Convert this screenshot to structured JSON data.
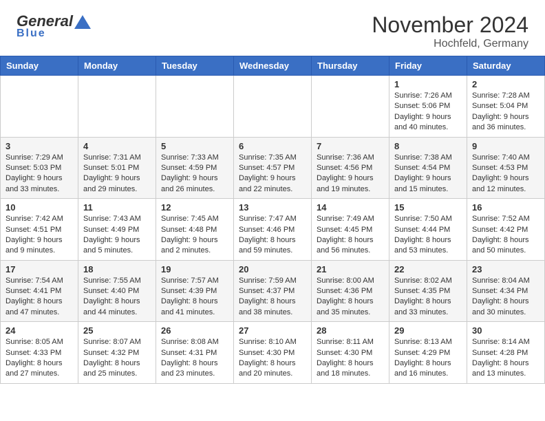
{
  "header": {
    "logo_general": "General",
    "logo_blue": "Blue",
    "month_title": "November 2024",
    "location": "Hochfeld, Germany"
  },
  "days_of_week": [
    "Sunday",
    "Monday",
    "Tuesday",
    "Wednesday",
    "Thursday",
    "Friday",
    "Saturday"
  ],
  "weeks": [
    {
      "days": [
        {
          "num": "",
          "detail": ""
        },
        {
          "num": "",
          "detail": ""
        },
        {
          "num": "",
          "detail": ""
        },
        {
          "num": "",
          "detail": ""
        },
        {
          "num": "",
          "detail": ""
        },
        {
          "num": "1",
          "detail": "Sunrise: 7:26 AM\nSunset: 5:06 PM\nDaylight: 9 hours and 40 minutes."
        },
        {
          "num": "2",
          "detail": "Sunrise: 7:28 AM\nSunset: 5:04 PM\nDaylight: 9 hours and 36 minutes."
        }
      ]
    },
    {
      "days": [
        {
          "num": "3",
          "detail": "Sunrise: 7:29 AM\nSunset: 5:03 PM\nDaylight: 9 hours and 33 minutes."
        },
        {
          "num": "4",
          "detail": "Sunrise: 7:31 AM\nSunset: 5:01 PM\nDaylight: 9 hours and 29 minutes."
        },
        {
          "num": "5",
          "detail": "Sunrise: 7:33 AM\nSunset: 4:59 PM\nDaylight: 9 hours and 26 minutes."
        },
        {
          "num": "6",
          "detail": "Sunrise: 7:35 AM\nSunset: 4:57 PM\nDaylight: 9 hours and 22 minutes."
        },
        {
          "num": "7",
          "detail": "Sunrise: 7:36 AM\nSunset: 4:56 PM\nDaylight: 9 hours and 19 minutes."
        },
        {
          "num": "8",
          "detail": "Sunrise: 7:38 AM\nSunset: 4:54 PM\nDaylight: 9 hours and 15 minutes."
        },
        {
          "num": "9",
          "detail": "Sunrise: 7:40 AM\nSunset: 4:53 PM\nDaylight: 9 hours and 12 minutes."
        }
      ]
    },
    {
      "days": [
        {
          "num": "10",
          "detail": "Sunrise: 7:42 AM\nSunset: 4:51 PM\nDaylight: 9 hours and 9 minutes."
        },
        {
          "num": "11",
          "detail": "Sunrise: 7:43 AM\nSunset: 4:49 PM\nDaylight: 9 hours and 5 minutes."
        },
        {
          "num": "12",
          "detail": "Sunrise: 7:45 AM\nSunset: 4:48 PM\nDaylight: 9 hours and 2 minutes."
        },
        {
          "num": "13",
          "detail": "Sunrise: 7:47 AM\nSunset: 4:46 PM\nDaylight: 8 hours and 59 minutes."
        },
        {
          "num": "14",
          "detail": "Sunrise: 7:49 AM\nSunset: 4:45 PM\nDaylight: 8 hours and 56 minutes."
        },
        {
          "num": "15",
          "detail": "Sunrise: 7:50 AM\nSunset: 4:44 PM\nDaylight: 8 hours and 53 minutes."
        },
        {
          "num": "16",
          "detail": "Sunrise: 7:52 AM\nSunset: 4:42 PM\nDaylight: 8 hours and 50 minutes."
        }
      ]
    },
    {
      "days": [
        {
          "num": "17",
          "detail": "Sunrise: 7:54 AM\nSunset: 4:41 PM\nDaylight: 8 hours and 47 minutes."
        },
        {
          "num": "18",
          "detail": "Sunrise: 7:55 AM\nSunset: 4:40 PM\nDaylight: 8 hours and 44 minutes."
        },
        {
          "num": "19",
          "detail": "Sunrise: 7:57 AM\nSunset: 4:39 PM\nDaylight: 8 hours and 41 minutes."
        },
        {
          "num": "20",
          "detail": "Sunrise: 7:59 AM\nSunset: 4:37 PM\nDaylight: 8 hours and 38 minutes."
        },
        {
          "num": "21",
          "detail": "Sunrise: 8:00 AM\nSunset: 4:36 PM\nDaylight: 8 hours and 35 minutes."
        },
        {
          "num": "22",
          "detail": "Sunrise: 8:02 AM\nSunset: 4:35 PM\nDaylight: 8 hours and 33 minutes."
        },
        {
          "num": "23",
          "detail": "Sunrise: 8:04 AM\nSunset: 4:34 PM\nDaylight: 8 hours and 30 minutes."
        }
      ]
    },
    {
      "days": [
        {
          "num": "24",
          "detail": "Sunrise: 8:05 AM\nSunset: 4:33 PM\nDaylight: 8 hours and 27 minutes."
        },
        {
          "num": "25",
          "detail": "Sunrise: 8:07 AM\nSunset: 4:32 PM\nDaylight: 8 hours and 25 minutes."
        },
        {
          "num": "26",
          "detail": "Sunrise: 8:08 AM\nSunset: 4:31 PM\nDaylight: 8 hours and 23 minutes."
        },
        {
          "num": "27",
          "detail": "Sunrise: 8:10 AM\nSunset: 4:30 PM\nDaylight: 8 hours and 20 minutes."
        },
        {
          "num": "28",
          "detail": "Sunrise: 8:11 AM\nSunset: 4:30 PM\nDaylight: 8 hours and 18 minutes."
        },
        {
          "num": "29",
          "detail": "Sunrise: 8:13 AM\nSunset: 4:29 PM\nDaylight: 8 hours and 16 minutes."
        },
        {
          "num": "30",
          "detail": "Sunrise: 8:14 AM\nSunset: 4:28 PM\nDaylight: 8 hours and 13 minutes."
        }
      ]
    }
  ]
}
